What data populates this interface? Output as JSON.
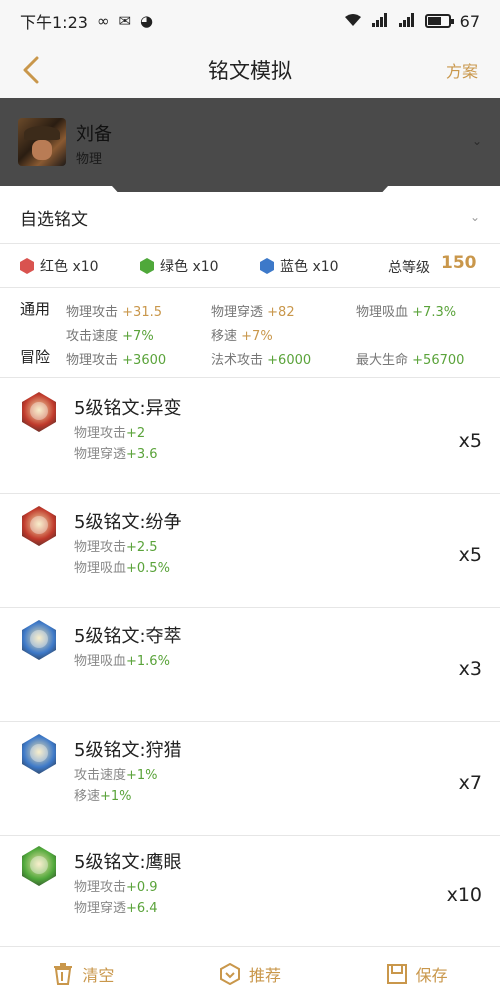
{
  "status_bar": {
    "time": "下午1:23",
    "battery": "67",
    "battery_level": 0.67
  },
  "nav": {
    "title": "铭文模拟",
    "right_action": "方案"
  },
  "hero": {
    "name": "刘备",
    "class": "物理"
  },
  "selector": {
    "label": "自选铭文"
  },
  "colors": [
    {
      "label": "红色 x10",
      "color": "#d9534f"
    },
    {
      "label": "绿色 x10",
      "color": "#4fa83a"
    },
    {
      "label": "蓝色 x10",
      "color": "#3d79c9"
    }
  ],
  "total": {
    "label": "总等级",
    "value": "150"
  },
  "attributes": {
    "general_label": "通用",
    "adventure_label": "冒险",
    "general": [
      {
        "name": "物理攻击",
        "value": "+31.5",
        "tone": "orange"
      },
      {
        "name": "物理穿透",
        "value": "+82",
        "tone": "orange"
      },
      {
        "name": "物理吸血",
        "value": "+7.3%",
        "tone": "green"
      },
      {
        "name": "攻击速度",
        "value": "+7%",
        "tone": "green"
      },
      {
        "name": "移速",
        "value": "+7%",
        "tone": "orange"
      }
    ],
    "adventure": [
      {
        "name": "物理攻击",
        "value": "+3600",
        "tone": "green"
      },
      {
        "name": "法术攻击",
        "value": "+6000",
        "tone": "green"
      },
      {
        "name": "最大生命",
        "value": "+56700",
        "tone": "green"
      }
    ]
  },
  "runes": [
    {
      "name": "5级铭文:异变",
      "count": "x5",
      "icon_color": "#c0392b",
      "stats": [
        {
          "name": "物理攻击",
          "value": "+2"
        },
        {
          "name": "物理穿透",
          "value": "+3.6"
        }
      ]
    },
    {
      "name": "5级铭文:纷争",
      "count": "x5",
      "icon_color": "#c0392b",
      "stats": [
        {
          "name": "物理攻击",
          "value": "+2.5"
        },
        {
          "name": "物理吸血",
          "value": "+0.5%"
        }
      ]
    },
    {
      "name": "5级铭文:夺萃",
      "count": "x3",
      "icon_color": "#3d79c9",
      "stats": [
        {
          "name": "物理吸血",
          "value": "+1.6%"
        }
      ]
    },
    {
      "name": "5级铭文:狩猎",
      "count": "x7",
      "icon_color": "#3d79c9",
      "stats": [
        {
          "name": "攻击速度",
          "value": "+1%"
        },
        {
          "name": "移速",
          "value": "+1%"
        }
      ]
    },
    {
      "name": "5级铭文:鹰眼",
      "count": "x10",
      "icon_color": "#4fa83a",
      "stats": [
        {
          "name": "物理攻击",
          "value": "+0.9"
        },
        {
          "name": "物理穿透",
          "value": "+6.4"
        }
      ]
    }
  ],
  "bottom_bar": {
    "clear": "清空",
    "recommend": "推荐",
    "save": "保存"
  }
}
